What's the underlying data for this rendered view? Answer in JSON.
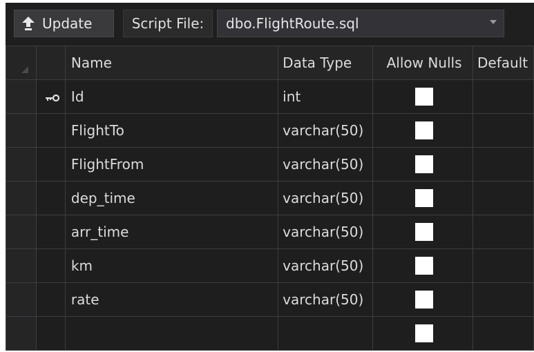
{
  "toolbar": {
    "update_label": "Update",
    "script_file_label": "Script File:",
    "script_file_value": "dbo.FlightRoute.sql"
  },
  "grid": {
    "headers": [
      "Name",
      "Data Type",
      "Allow Nulls",
      "Default"
    ],
    "rows": [
      {
        "name": "Id",
        "type": "int",
        "primary_key": true,
        "allow_nulls": false
      },
      {
        "name": "FlightTo",
        "type": "varchar(50)",
        "primary_key": false,
        "allow_nulls": false
      },
      {
        "name": "FlightFrom",
        "type": "varchar(50)",
        "primary_key": false,
        "allow_nulls": false
      },
      {
        "name": "dep_time",
        "type": "varchar(50)",
        "primary_key": false,
        "allow_nulls": false
      },
      {
        "name": "arr_time",
        "type": "varchar(50)",
        "primary_key": false,
        "allow_nulls": false
      },
      {
        "name": "km",
        "type": "varchar(50)",
        "primary_key": false,
        "allow_nulls": false
      },
      {
        "name": "rate",
        "type": "varchar(50)",
        "primary_key": false,
        "allow_nulls": false
      },
      {
        "name": "",
        "type": "",
        "primary_key": false,
        "allow_nulls": false
      }
    ]
  },
  "icons": {
    "update": "arrow-up-icon",
    "primary_key": "key-icon",
    "dropdown": "chevron-down-icon"
  },
  "colors": {
    "background": "#1e1e1e",
    "grid_line": "#3e3e42",
    "text": "#dcdcdc",
    "checkbox": "#ffffff"
  }
}
